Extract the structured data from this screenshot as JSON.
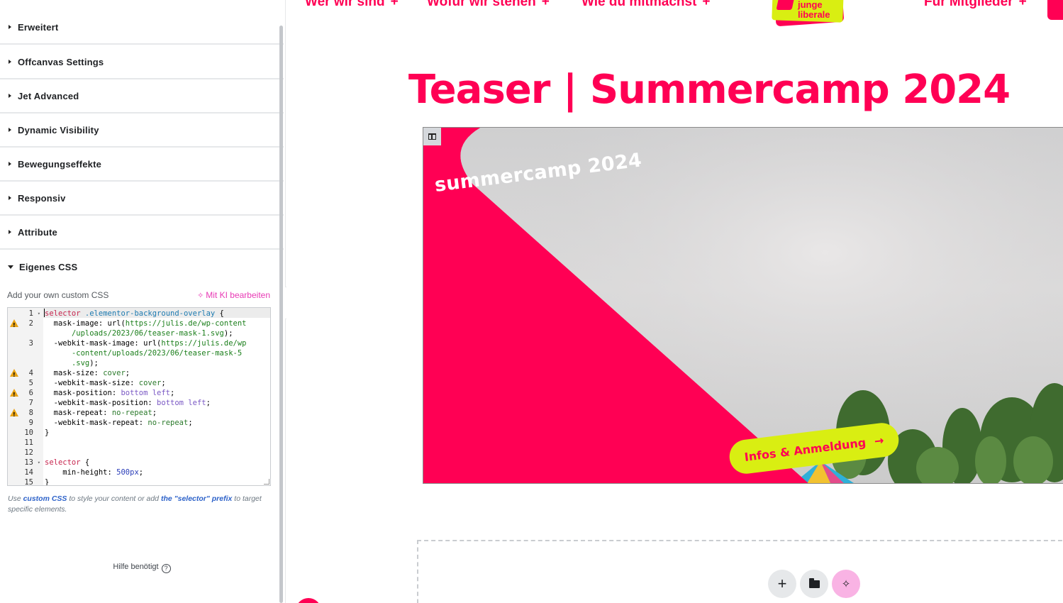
{
  "panel": {
    "sections": [
      {
        "label": "Erweitert"
      },
      {
        "label": "Offcanvas Settings"
      },
      {
        "label": "Jet Advanced"
      },
      {
        "label": "Dynamic Visibility"
      },
      {
        "label": "Bewegungseffekte"
      },
      {
        "label": "Responsiv"
      },
      {
        "label": "Attribute"
      },
      {
        "label": "Eigenes CSS",
        "open": true
      }
    ],
    "css_hint": "Add your own custom CSS",
    "ai_edit_label": "Mit KI bearbeiten",
    "code": {
      "line_numbers": [
        "1",
        "2",
        "3",
        "4",
        "5",
        "6",
        "7",
        "8",
        "9",
        "10",
        "11",
        "12",
        "13",
        "14",
        "15"
      ],
      "warning_lines": [
        "2",
        "4",
        "6",
        "8"
      ],
      "fold_lines": [
        "1",
        "13"
      ],
      "lines": [
        "selector .elementor-background-overlay {",
        "  mask-image: url(https://julis.de/wp-content",
        "      /uploads/2023/06/teaser-mask-1.svg);",
        "  -webkit-mask-image: url(https://julis.de/wp",
        "      -content/uploads/2023/06/teaser-mask-5",
        "      .svg);",
        "  mask-size: cover;",
        "  -webkit-mask-size: cover;",
        "  mask-position: bottom left;",
        "  -webkit-mask-position: bottom left;",
        "  mask-repeat: no-repeat;",
        "  -webkit-mask-repeat: no-repeat;",
        "}",
        "",
        "",
        "selector {",
        "    min-height: 500px;",
        "}"
      ]
    },
    "note": {
      "prefix": "Use ",
      "link1": "custom CSS",
      "middle": " to style your content or add ",
      "link2": "the \"selector\" prefix",
      "suffix": " to target specific elements."
    },
    "help_label": "Hilfe benötigt",
    "help_icon": "?"
  },
  "preview": {
    "nav": [
      {
        "label": "Wer wir sind",
        "icon": "+"
      },
      {
        "label": "Wofür wir stehen",
        "icon": "+"
      },
      {
        "label": "Wie du mitmachst",
        "icon": "+"
      },
      {
        "label": "Für Mitglieder",
        "icon": "+"
      }
    ],
    "logo": {
      "line1": "junge",
      "line2": "liberale"
    },
    "page_title": "Teaser | Summercamp 2024",
    "teaser": {
      "heading": "summercamp 2024",
      "button_label": "Infos & Anmeldung",
      "button_arrow": "→"
    },
    "toolbar": {
      "add_icon": "+",
      "ai_icon": "✧"
    }
  },
  "colors": {
    "brand_pink": "#ff0054",
    "brand_yellow": "#d9ee12",
    "ai_pink": "#e83ab5",
    "link_blue": "#2d62c9"
  }
}
